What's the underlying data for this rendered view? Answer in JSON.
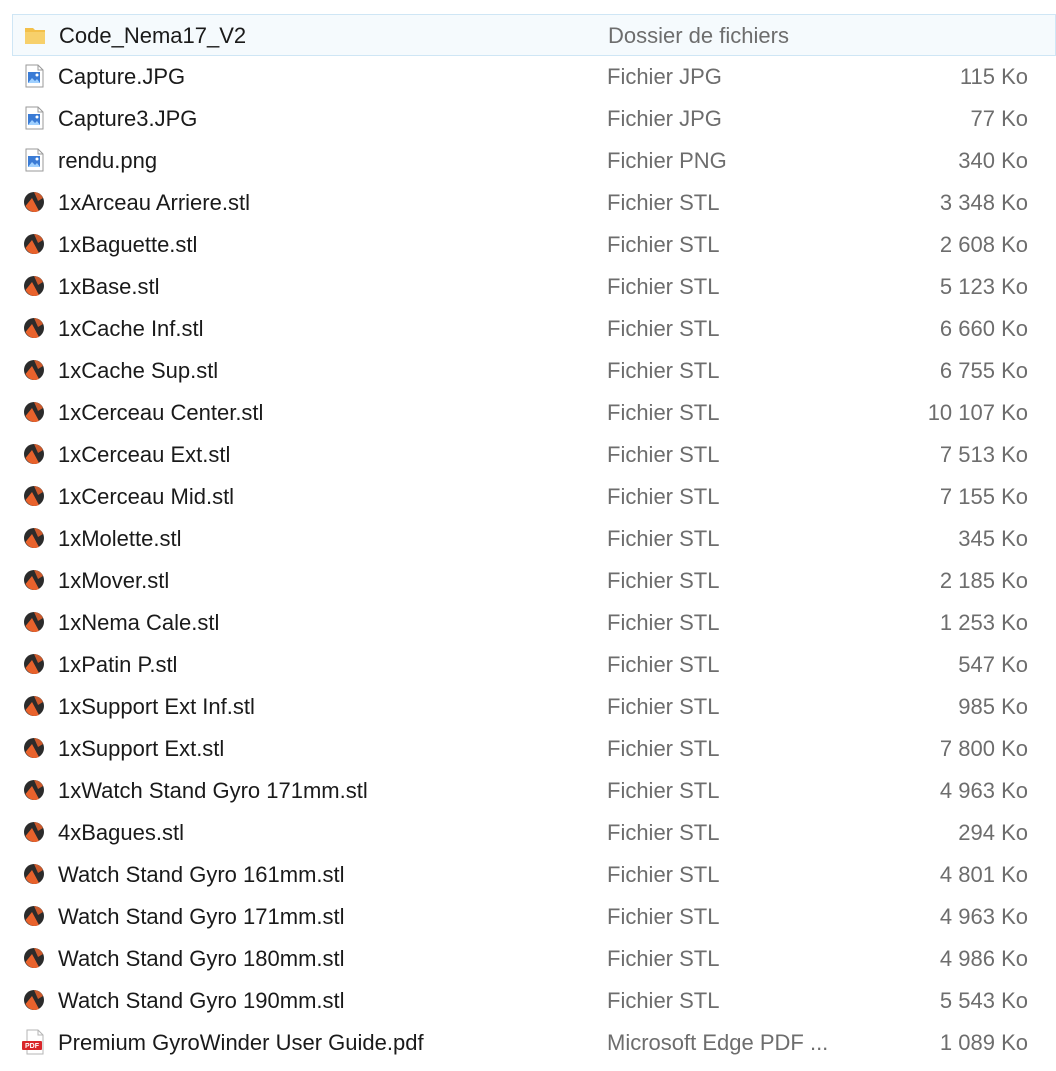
{
  "files": [
    {
      "name": "Code_Nema17_V2",
      "type": "Dossier de fichiers",
      "size": "",
      "icon": "folder-icon"
    },
    {
      "name": "Capture.JPG",
      "type": "Fichier JPG",
      "size": "115 Ko",
      "icon": "image-file-icon"
    },
    {
      "name": "Capture3.JPG",
      "type": "Fichier JPG",
      "size": "77 Ko",
      "icon": "image-file-icon"
    },
    {
      "name": "rendu.png",
      "type": "Fichier PNG",
      "size": "340 Ko",
      "icon": "image-file-icon"
    },
    {
      "name": "1xArceau Arriere.stl",
      "type": "Fichier STL",
      "size": "3 348 Ko",
      "icon": "stl-file-icon"
    },
    {
      "name": "1xBaguette.stl",
      "type": "Fichier STL",
      "size": "2 608 Ko",
      "icon": "stl-file-icon"
    },
    {
      "name": "1xBase.stl",
      "type": "Fichier STL",
      "size": "5 123 Ko",
      "icon": "stl-file-icon"
    },
    {
      "name": "1xCache Inf.stl",
      "type": "Fichier STL",
      "size": "6 660 Ko",
      "icon": "stl-file-icon"
    },
    {
      "name": "1xCache Sup.stl",
      "type": "Fichier STL",
      "size": "6 755 Ko",
      "icon": "stl-file-icon"
    },
    {
      "name": "1xCerceau Center.stl",
      "type": "Fichier STL",
      "size": "10 107 Ko",
      "icon": "stl-file-icon"
    },
    {
      "name": "1xCerceau Ext.stl",
      "type": "Fichier STL",
      "size": "7 513 Ko",
      "icon": "stl-file-icon"
    },
    {
      "name": "1xCerceau Mid.stl",
      "type": "Fichier STL",
      "size": "7 155 Ko",
      "icon": "stl-file-icon"
    },
    {
      "name": "1xMolette.stl",
      "type": "Fichier STL",
      "size": "345 Ko",
      "icon": "stl-file-icon"
    },
    {
      "name": "1xMover.stl",
      "type": "Fichier STL",
      "size": "2 185 Ko",
      "icon": "stl-file-icon"
    },
    {
      "name": "1xNema Cale.stl",
      "type": "Fichier STL",
      "size": "1 253 Ko",
      "icon": "stl-file-icon"
    },
    {
      "name": "1xPatin P.stl",
      "type": "Fichier STL",
      "size": "547 Ko",
      "icon": "stl-file-icon"
    },
    {
      "name": "1xSupport Ext Inf.stl",
      "type": "Fichier STL",
      "size": "985 Ko",
      "icon": "stl-file-icon"
    },
    {
      "name": "1xSupport Ext.stl",
      "type": "Fichier STL",
      "size": "7 800 Ko",
      "icon": "stl-file-icon"
    },
    {
      "name": "1xWatch Stand Gyro 171mm.stl",
      "type": "Fichier STL",
      "size": "4 963 Ko",
      "icon": "stl-file-icon"
    },
    {
      "name": "4xBagues.stl",
      "type": "Fichier STL",
      "size": "294 Ko",
      "icon": "stl-file-icon"
    },
    {
      "name": "Watch Stand Gyro 161mm.stl",
      "type": "Fichier STL",
      "size": "4 801 Ko",
      "icon": "stl-file-icon"
    },
    {
      "name": "Watch Stand Gyro 171mm.stl",
      "type": "Fichier STL",
      "size": "4 963 Ko",
      "icon": "stl-file-icon"
    },
    {
      "name": "Watch Stand Gyro 180mm.stl",
      "type": "Fichier STL",
      "size": "4 986 Ko",
      "icon": "stl-file-icon"
    },
    {
      "name": "Watch Stand Gyro 190mm.stl",
      "type": "Fichier STL",
      "size": "5 543 Ko",
      "icon": "stl-file-icon"
    },
    {
      "name": "Premium GyroWinder User Guide.pdf",
      "type": "Microsoft Edge PDF ...",
      "size": "1 089 Ko",
      "icon": "pdf-file-icon"
    }
  ],
  "colors": {
    "folder": "#f3c04a",
    "stl_dark": "#2b2b2b",
    "stl_accent": "#e8622c",
    "pdf_red": "#d9262a",
    "image_blue": "#3a7bd5",
    "selection_bg": "#f5fafd",
    "selection_border": "#cfe6f5",
    "secondary_text": "#6d6d6d"
  },
  "icon_labels": {
    "pdf": "PDF"
  }
}
